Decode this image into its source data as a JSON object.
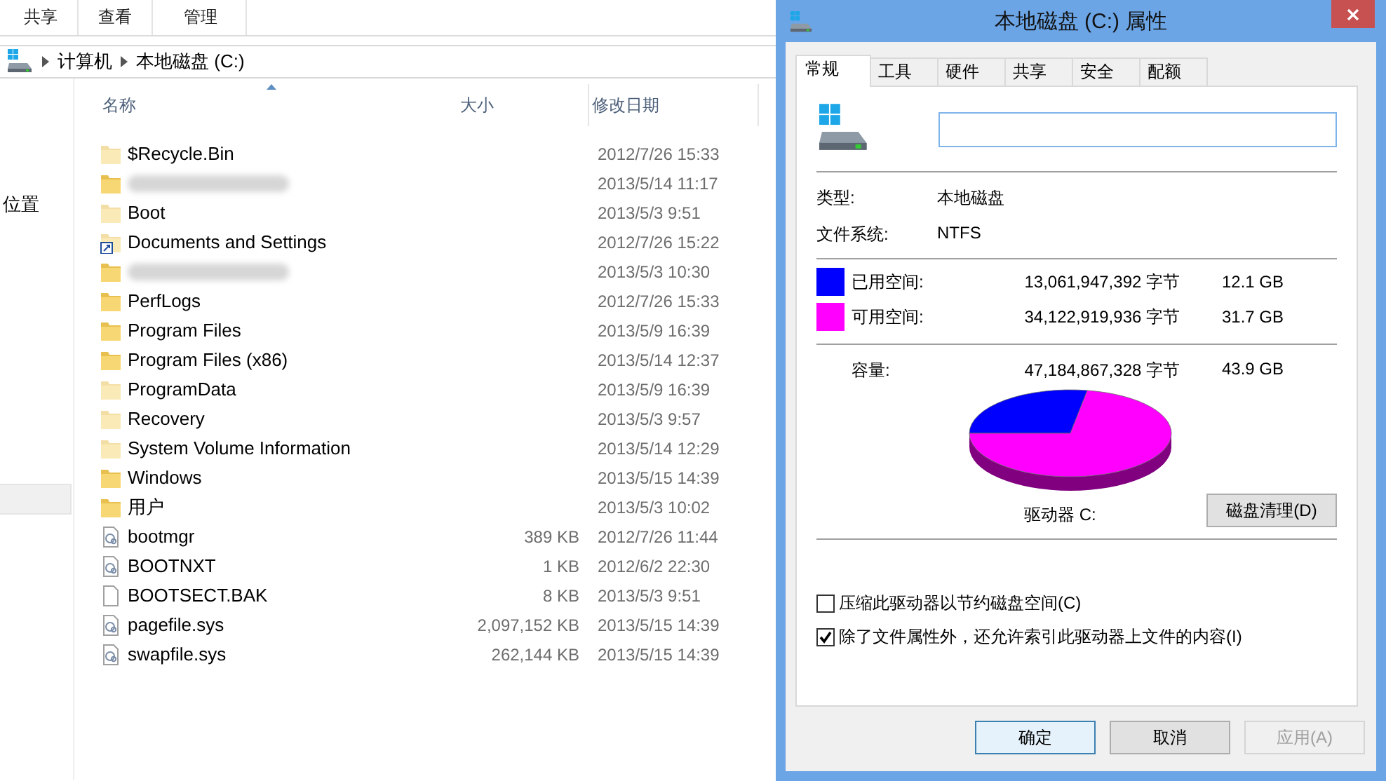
{
  "explorer": {
    "ribbon_tabs": [
      "共享",
      "查看",
      "管理"
    ],
    "breadcrumb": [
      "计算机",
      "本地磁盘 (C:)"
    ],
    "nav": {
      "partial_label": "位置",
      "highlight": true
    },
    "columns": [
      "名称",
      "大小",
      "修改日期"
    ],
    "rows": [
      {
        "kind": "folder",
        "name": "$Recycle.Bin",
        "hidden": true,
        "size": "",
        "date": "2012/7/26 15:33"
      },
      {
        "kind": "folder",
        "redacted": true,
        "hidden": false,
        "size": "",
        "date": "2013/5/14 11:17"
      },
      {
        "kind": "folder",
        "name": "Boot",
        "hidden": true,
        "size": "",
        "date": "2013/5/3 9:51"
      },
      {
        "kind": "shortcut",
        "name": "Documents and Settings",
        "hidden": true,
        "size": "",
        "date": "2012/7/26 15:22"
      },
      {
        "kind": "folder",
        "redacted": true,
        "hidden": false,
        "size": "",
        "date": "2013/5/3 10:30"
      },
      {
        "kind": "folder",
        "name": "PerfLogs",
        "hidden": false,
        "size": "",
        "date": "2012/7/26 15:33"
      },
      {
        "kind": "folder",
        "name": "Program Files",
        "hidden": false,
        "size": "",
        "date": "2013/5/9 16:39"
      },
      {
        "kind": "folder",
        "name": "Program Files (x86)",
        "hidden": false,
        "size": "",
        "date": "2013/5/14 12:37"
      },
      {
        "kind": "folder",
        "name": "ProgramData",
        "hidden": true,
        "size": "",
        "date": "2013/5/9 16:39"
      },
      {
        "kind": "folder",
        "name": "Recovery",
        "hidden": true,
        "size": "",
        "date": "2013/5/3 9:57"
      },
      {
        "kind": "folder",
        "name": "System Volume Information",
        "hidden": true,
        "size": "",
        "date": "2013/5/14 12:29"
      },
      {
        "kind": "folder",
        "name": "Windows",
        "hidden": false,
        "size": "",
        "date": "2013/5/15 14:39"
      },
      {
        "kind": "folder",
        "name": "用户",
        "hidden": false,
        "size": "",
        "date": "2013/5/3 10:02"
      },
      {
        "kind": "system-file",
        "name": "bootmgr",
        "hidden": false,
        "size": "389 KB",
        "date": "2012/7/26 11:44"
      },
      {
        "kind": "system-file",
        "name": "BOOTNXT",
        "hidden": false,
        "size": "1 KB",
        "date": "2012/6/2 22:30"
      },
      {
        "kind": "file",
        "name": "BOOTSECT.BAK",
        "hidden": false,
        "size": "8 KB",
        "date": "2013/5/3 9:51"
      },
      {
        "kind": "system-file",
        "name": "pagefile.sys",
        "hidden": false,
        "size": "2,097,152 KB",
        "date": "2013/5/15 14:39"
      },
      {
        "kind": "system-file",
        "name": "swapfile.sys",
        "hidden": false,
        "size": "262,144 KB",
        "date": "2013/5/15 14:39"
      }
    ]
  },
  "dialog": {
    "title": "本地磁盘 (C:) 属性",
    "tabs": [
      {
        "label": "常规",
        "selected": true
      },
      {
        "label": "工具",
        "selected": false
      },
      {
        "label": "硬件",
        "selected": false
      },
      {
        "label": "共享",
        "selected": false
      },
      {
        "label": "安全",
        "selected": false
      },
      {
        "label": "配额",
        "selected": false
      }
    ],
    "info": [
      {
        "label": "类型:",
        "value": "本地磁盘"
      },
      {
        "label": "文件系统:",
        "value": "NTFS"
      }
    ],
    "space": [
      {
        "label": "已用空间:",
        "bytes": "13,061,947,392 字节",
        "size": "12.1 GB",
        "color": "#0000ff"
      },
      {
        "label": "可用空间:",
        "bytes": "34,122,919,936 字节",
        "size": "31.7 GB",
        "color": "#ff00ff"
      }
    ],
    "capacity": {
      "label": "容量:",
      "bytes": "47,184,867,328 字节",
      "size": "43.9 GB"
    },
    "drive_label": "驱动器 C:",
    "cleanup_button": "磁盘清理(D)",
    "options": [
      {
        "label": "压缩此驱动器以节约磁盘空间(C)",
        "checked": false
      },
      {
        "label": "除了文件属性外，还允许索引此驱动器上文件的内容(I)",
        "checked": true
      }
    ],
    "buttons": [
      {
        "label": "确定",
        "default": true,
        "disabled": false
      },
      {
        "label": "取消",
        "default": false,
        "disabled": false
      },
      {
        "label": "应用(A)",
        "default": false,
        "disabled": true
      }
    ]
  }
}
